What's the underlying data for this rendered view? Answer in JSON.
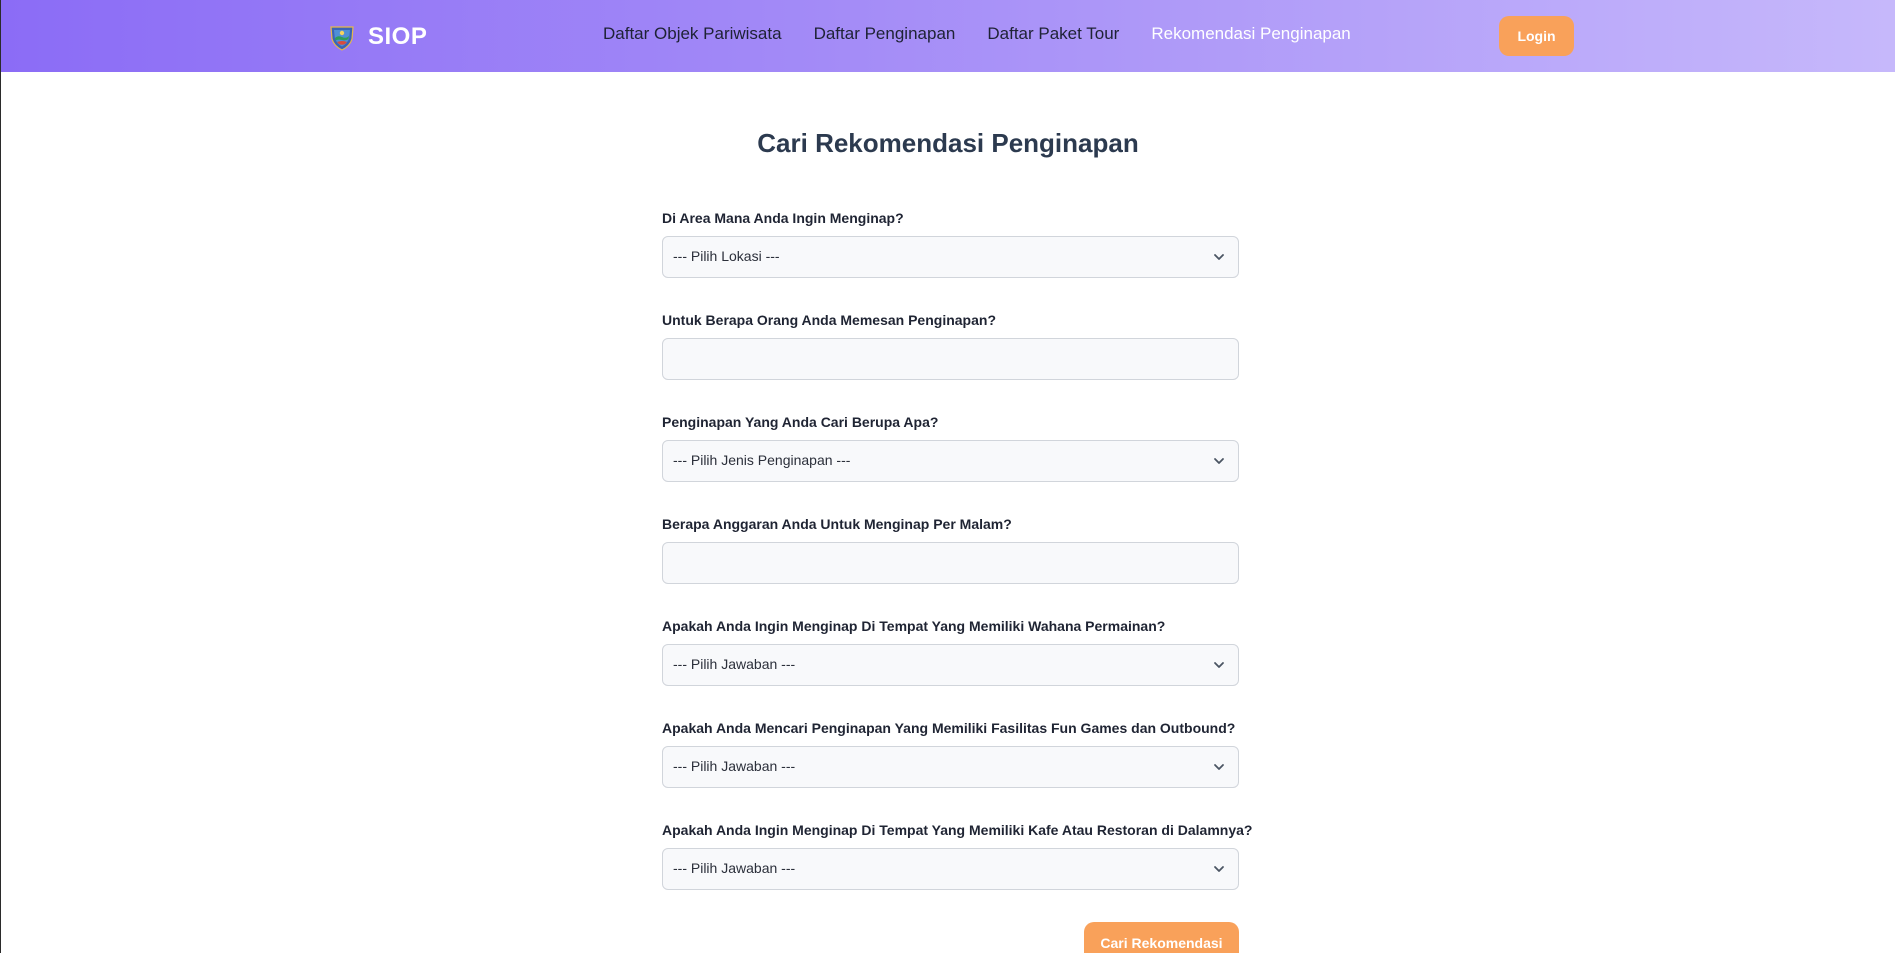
{
  "header": {
    "brand": "SIOP",
    "logo_icon": "regional-emblem-icon",
    "nav": [
      {
        "label": "Daftar Objek Pariwisata",
        "active": false
      },
      {
        "label": "Daftar Penginapan",
        "active": false
      },
      {
        "label": "Daftar Paket Tour",
        "active": false
      },
      {
        "label": "Rekomendasi Penginapan",
        "active": true
      }
    ],
    "login_label": "Login"
  },
  "main": {
    "title": "Cari Rekomendasi Penginapan",
    "fields": [
      {
        "label": "Di Area Mana Anda Ingin Menginap?",
        "type": "select",
        "value": "--- Pilih Lokasi ---"
      },
      {
        "label": "Untuk Berapa Orang Anda Memesan Penginapan?",
        "type": "input",
        "value": ""
      },
      {
        "label": "Penginapan Yang Anda Cari Berupa Apa?",
        "type": "select",
        "value": "--- Pilih Jenis Penginapan ---"
      },
      {
        "label": "Berapa Anggaran Anda Untuk Menginap Per Malam?",
        "type": "input",
        "value": ""
      },
      {
        "label": "Apakah Anda Ingin Menginap Di Tempat Yang Memiliki Wahana Permainan?",
        "type": "select",
        "value": "--- Pilih Jawaban ---"
      },
      {
        "label": "Apakah Anda Mencari Penginapan Yang Memiliki Fasilitas Fun Games dan Outbound?",
        "type": "select",
        "value": "--- Pilih Jawaban ---"
      },
      {
        "label": "Apakah Anda Ingin Menginap Di Tempat Yang Memiliki Kafe Atau Restoran di Dalamnya?",
        "type": "select",
        "value": "--- Pilih Jawaban ---"
      }
    ],
    "submit_label": "Cari Rekomendasi"
  },
  "colors": {
    "nav_gradient_start": "#8b6cf6",
    "nav_gradient_end": "#c6b8fb",
    "accent": "#f9a15a",
    "title": "#2c3a4f"
  }
}
